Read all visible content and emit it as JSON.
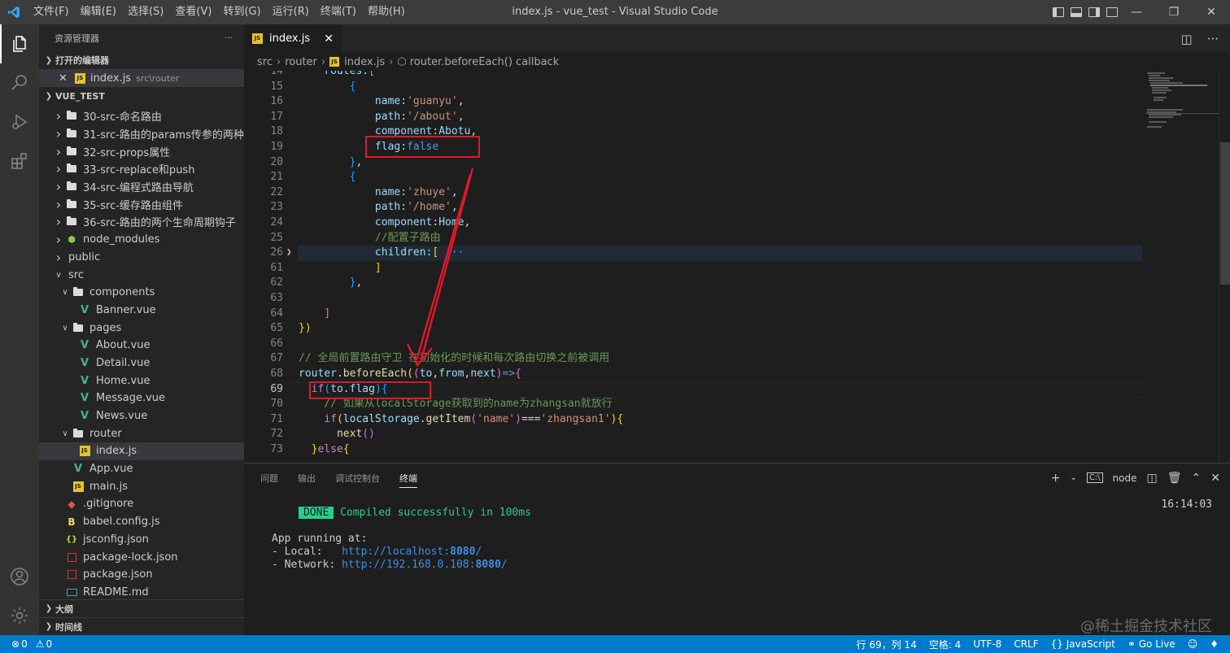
{
  "window": {
    "title": "index.js - vue_test - Visual Studio Code",
    "menu": [
      "文件(F)",
      "编辑(E)",
      "选择(S)",
      "查看(V)",
      "转到(G)",
      "运行(R)",
      "终端(T)",
      "帮助(H)"
    ]
  },
  "sidebar": {
    "title": "资源管理器",
    "more": "···",
    "open_editors_title": "打开的编辑器",
    "open_editor": {
      "name": "index.js",
      "path": "src\\router"
    },
    "project_title": "VUE_TEST",
    "tree": [
      {
        "label": "30-src-命名路由",
        "depth": 1,
        "kind": "folder",
        "open": false
      },
      {
        "label": "31-src-路由的params传参的两种...",
        "depth": 1,
        "kind": "folder",
        "open": false
      },
      {
        "label": "32-src-props属性",
        "depth": 1,
        "kind": "folder",
        "open": false
      },
      {
        "label": "33-src-replace和push",
        "depth": 1,
        "kind": "folder",
        "open": false
      },
      {
        "label": "34-src-编程式路由导航",
        "depth": 1,
        "kind": "folder",
        "open": false
      },
      {
        "label": "35-src-缓存路由组件",
        "depth": 1,
        "kind": "folder",
        "open": false
      },
      {
        "label": "36-src-路由的两个生命周期钩子",
        "depth": 1,
        "kind": "folder",
        "open": false
      },
      {
        "label": "node_modules",
        "depth": 1,
        "kind": "nodemod",
        "open": false
      },
      {
        "label": "public",
        "depth": 1,
        "kind": "plain",
        "open": false
      },
      {
        "label": "src",
        "depth": 1,
        "kind": "plain",
        "open": true
      },
      {
        "label": "components",
        "depth": 2,
        "kind": "folder",
        "open": true
      },
      {
        "label": "Banner.vue",
        "depth": 3,
        "kind": "vue"
      },
      {
        "label": "pages",
        "depth": 2,
        "kind": "folder",
        "open": true
      },
      {
        "label": "About.vue",
        "depth": 3,
        "kind": "vue"
      },
      {
        "label": "Detail.vue",
        "depth": 3,
        "kind": "vue"
      },
      {
        "label": "Home.vue",
        "depth": 3,
        "kind": "vue"
      },
      {
        "label": "Message.vue",
        "depth": 3,
        "kind": "vue"
      },
      {
        "label": "News.vue",
        "depth": 3,
        "kind": "vue"
      },
      {
        "label": "router",
        "depth": 2,
        "kind": "folder",
        "open": true
      },
      {
        "label": "index.js",
        "depth": 3,
        "kind": "js",
        "selected": true
      },
      {
        "label": "App.vue",
        "depth": 2,
        "kind": "vue"
      },
      {
        "label": "main.js",
        "depth": 2,
        "kind": "js"
      },
      {
        "label": ".gitignore",
        "depth": 1,
        "kind": "git"
      },
      {
        "label": "babel.config.js",
        "depth": 1,
        "kind": "babel"
      },
      {
        "label": "jsconfig.json",
        "depth": 1,
        "kind": "json"
      },
      {
        "label": "package-lock.json",
        "depth": 1,
        "kind": "npm"
      },
      {
        "label": "package.json",
        "depth": 1,
        "kind": "npm"
      },
      {
        "label": "README.md",
        "depth": 1,
        "kind": "md"
      }
    ],
    "outline_title": "大纲",
    "timeline_title": "时间线"
  },
  "editor": {
    "tab_label": "index.js",
    "breadcrumb": [
      "src",
      "router",
      "index.js",
      "router.beforeEach() callback"
    ],
    "current_line": "69",
    "lines": [
      {
        "n": "14",
        "code": [
          [
            "    ",
            ""
          ],
          [
            "routes:",
            "p"
          ],
          [
            "[",
            "b2"
          ]
        ]
      },
      {
        "n": "15",
        "code": [
          [
            "        ",
            ""
          ],
          [
            "{",
            "b3"
          ]
        ]
      },
      {
        "n": "16",
        "code": [
          [
            "            ",
            ""
          ],
          [
            "name:",
            "p"
          ],
          [
            "'guanyu'",
            "s"
          ],
          [
            ",",
            ""
          ]
        ]
      },
      {
        "n": "17",
        "code": [
          [
            "            ",
            ""
          ],
          [
            "path:",
            "p"
          ],
          [
            "'/about'",
            "s"
          ],
          [
            ",",
            ""
          ]
        ]
      },
      {
        "n": "18",
        "code": [
          [
            "            ",
            ""
          ],
          [
            "component:",
            "p"
          ],
          [
            "Abotu",
            "p"
          ],
          [
            ",",
            ""
          ]
        ]
      },
      {
        "n": "19",
        "code": [
          [
            "            ",
            ""
          ],
          [
            "flag:",
            "p"
          ],
          [
            "false",
            "k"
          ]
        ]
      },
      {
        "n": "20",
        "code": [
          [
            "        ",
            ""
          ],
          [
            "}",
            "b3"
          ],
          [
            ",",
            ""
          ]
        ]
      },
      {
        "n": "21",
        "code": [
          [
            "        ",
            ""
          ],
          [
            "{",
            "b3"
          ]
        ]
      },
      {
        "n": "22",
        "code": [
          [
            "            ",
            ""
          ],
          [
            "name:",
            "p"
          ],
          [
            "'zhuye'",
            "s"
          ],
          [
            ",",
            ""
          ]
        ]
      },
      {
        "n": "23",
        "code": [
          [
            "            ",
            ""
          ],
          [
            "path:",
            "p"
          ],
          [
            "'/home'",
            "s"
          ],
          [
            ",",
            ""
          ]
        ]
      },
      {
        "n": "24",
        "code": [
          [
            "            ",
            ""
          ],
          [
            "component:",
            "p"
          ],
          [
            "Home",
            "p"
          ],
          [
            ",",
            ""
          ]
        ]
      },
      {
        "n": "25",
        "code": [
          [
            "            ",
            ""
          ],
          [
            "//配置子路由",
            "c"
          ]
        ]
      },
      {
        "n": "26",
        "code": [
          [
            "            ",
            ""
          ],
          [
            "children:",
            "p"
          ],
          [
            "[",
            "b1"
          ],
          [
            " ···",
            "k"
          ]
        ]
      },
      {
        "n": "61",
        "code": [
          [
            "            ",
            ""
          ],
          [
            "]",
            "b1"
          ]
        ]
      },
      {
        "n": "62",
        "code": [
          [
            "        ",
            ""
          ],
          [
            "}",
            "b3"
          ],
          [
            ",",
            ""
          ]
        ]
      },
      {
        "n": "63",
        "code": [
          [
            "",
            ""
          ]
        ]
      },
      {
        "n": "64",
        "code": [
          [
            "    ",
            ""
          ],
          [
            "]",
            "b2"
          ]
        ]
      },
      {
        "n": "65",
        "code": [
          [
            "",
            ""
          ],
          [
            "})",
            "b1"
          ]
        ]
      },
      {
        "n": "66",
        "code": [
          [
            "",
            ""
          ]
        ]
      },
      {
        "n": "67",
        "code": [
          [
            "",
            ""
          ],
          [
            "// 全局前置路由守卫 在初始化的时候和每次路由切换之前被调用",
            "c"
          ]
        ]
      },
      {
        "n": "68",
        "code": [
          [
            "",
            ""
          ],
          [
            "router",
            "p"
          ],
          [
            ".",
            ""
          ],
          [
            "beforeEach",
            "f"
          ],
          [
            "(",
            "b1"
          ],
          [
            "(",
            "b2"
          ],
          [
            "to",
            "p"
          ],
          [
            ",",
            ""
          ],
          [
            "from",
            "p"
          ],
          [
            ",",
            ""
          ],
          [
            "next",
            "p"
          ],
          [
            ")",
            "b2"
          ],
          [
            "=>",
            "k"
          ],
          [
            "{",
            "b2"
          ]
        ]
      },
      {
        "n": "69",
        "code": [
          [
            "  ",
            ""
          ],
          [
            "if",
            "kc"
          ],
          [
            "(",
            "b3"
          ],
          [
            "to",
            "p"
          ],
          [
            ".",
            ""
          ],
          [
            "flag",
            "p"
          ],
          [
            ")",
            "b3"
          ],
          [
            "{",
            "b3"
          ]
        ]
      },
      {
        "n": "70",
        "code": [
          [
            "    ",
            ""
          ],
          [
            "// 如果从localStorage获取到的name为zhangsan就放行",
            "c"
          ]
        ]
      },
      {
        "n": "71",
        "code": [
          [
            "    ",
            ""
          ],
          [
            "if",
            "kc"
          ],
          [
            "(",
            "b1"
          ],
          [
            "localStorage",
            "p"
          ],
          [
            ".",
            ""
          ],
          [
            "getItem",
            "f"
          ],
          [
            "(",
            "b2"
          ],
          [
            "'name'",
            "s"
          ],
          [
            ")",
            "b2"
          ],
          [
            "===",
            ""
          ],
          [
            "'zhangsan1'",
            "s"
          ],
          [
            ")",
            "b1"
          ],
          [
            "{",
            "b1"
          ]
        ]
      },
      {
        "n": "72",
        "code": [
          [
            "      ",
            ""
          ],
          [
            "next",
            "f"
          ],
          [
            "()",
            "b2"
          ]
        ]
      },
      {
        "n": "73",
        "code": [
          [
            "  ",
            ""
          ],
          [
            "}",
            "b1"
          ],
          [
            "else",
            "kc"
          ],
          [
            "{",
            "b1"
          ]
        ]
      }
    ]
  },
  "panel": {
    "tabs": [
      "问题",
      "输出",
      "调试控制台",
      "终端"
    ],
    "active_tab": "终端",
    "terminal_name": "node",
    "done_badge": "DONE",
    "compiled": "Compiled successfully in 100ms",
    "time": "16:14:03",
    "app_running": "App running at:",
    "local_label": "- Local:   ",
    "local_url": "http://localhost:",
    "local_port": "8080",
    "network_label": "- Network: ",
    "network_url": "http://192.168.0.108:",
    "network_port": "8080",
    "trailing_slash": "/"
  },
  "statusbar": {
    "errors": "0",
    "warnings": "0",
    "position": "行 69，列 14",
    "spaces": "空格: 4",
    "encoding": "UTF-8",
    "eol": "CRLF",
    "language": "JavaScript",
    "golive": "Go Live"
  },
  "watermark": "@稀土掘金技术社区",
  "colors": {
    "accent": "#007acc",
    "annotation": "#e3162b",
    "titlebar": "#3c3c3c"
  }
}
